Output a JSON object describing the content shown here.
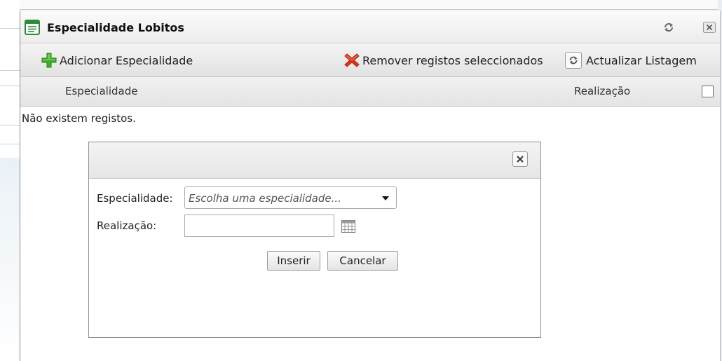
{
  "window": {
    "title": "Especialidade Lobitos"
  },
  "toolbar": {
    "add_label": "Adicionar Especialidade",
    "remove_label": "Remover registos seleccionados",
    "refresh_label": "Actualizar Listagem"
  },
  "grid": {
    "columns": [
      "Especialidade",
      "Realização"
    ],
    "select_all_checked": false,
    "empty_message": "Não existem registos."
  },
  "dialog": {
    "especialidade_label": "Especialidade:",
    "especialidade_placeholder": "Escolha uma especialidade...",
    "realizacao_label": "Realização:",
    "realizacao_value": "",
    "insert_label": "Inserir",
    "cancel_label": "Cancelar"
  },
  "icons": {
    "title": "form-icon",
    "title_refresh": "refresh-icon",
    "title_close": "close-icon",
    "add": "green-plus-icon",
    "remove": "red-x-icon",
    "refresh": "refresh-icon",
    "dialog_close": "close-icon",
    "select_arrow": "chevron-down-icon",
    "calendar": "calendar-icon"
  },
  "colors": {
    "add_icon": "#3fae2a",
    "remove_icon": "#e0321c",
    "title_icon": "#2f8a3a"
  }
}
